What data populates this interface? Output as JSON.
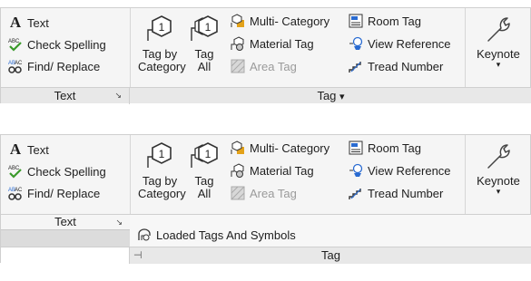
{
  "top": {
    "text_panel": {
      "text_label": "Text",
      "check_spelling_label": "Check Spelling",
      "find_replace_label": "Find/ Replace",
      "panel_title": "Text"
    },
    "tag_panel": {
      "tag_by_category_label_line1": "Tag by",
      "tag_by_category_label_line2": "Category",
      "tag_all_label_line1": "Tag",
      "tag_all_label_line2": "All",
      "multi_category_label": "Multi- Category",
      "material_tag_label": "Material Tag",
      "area_tag_label": "Area Tag",
      "room_tag_label": "Room Tag",
      "view_reference_label": "View Reference",
      "tread_number_label": "Tread Number",
      "panel_title": "Tag",
      "panel_title_arrow": "▾"
    },
    "keynote_panel": {
      "label": "Keynote",
      "arrow": "▾"
    }
  },
  "bottom": {
    "text_panel": {
      "text_label": "Text",
      "check_spelling_label": "Check Spelling",
      "find_replace_label": "Find/ Replace",
      "panel_title": "Text"
    },
    "tag_panel": {
      "tag_by_category_label_line1": "Tag by",
      "tag_by_category_label_line2": "Category",
      "tag_all_label_line1": "Tag",
      "tag_all_label_line2": "All",
      "multi_category_label": "Multi- Category",
      "material_tag_label": "Material Tag",
      "area_tag_label": "Area Tag",
      "room_tag_label": "Room Tag",
      "view_reference_label": "View Reference",
      "tread_number_label": "Tread Number",
      "panel_title": "Tag"
    },
    "keynote_panel": {
      "label": "Keynote",
      "arrow": "▾"
    },
    "flyout": {
      "loaded_tags_label": "Loaded Tags And Symbols"
    }
  },
  "icons": {
    "text": "A",
    "check_spelling": "ABC",
    "find_replace": "AB",
    "tag_number": "1",
    "launcher": "↘",
    "pin": "⊣"
  }
}
